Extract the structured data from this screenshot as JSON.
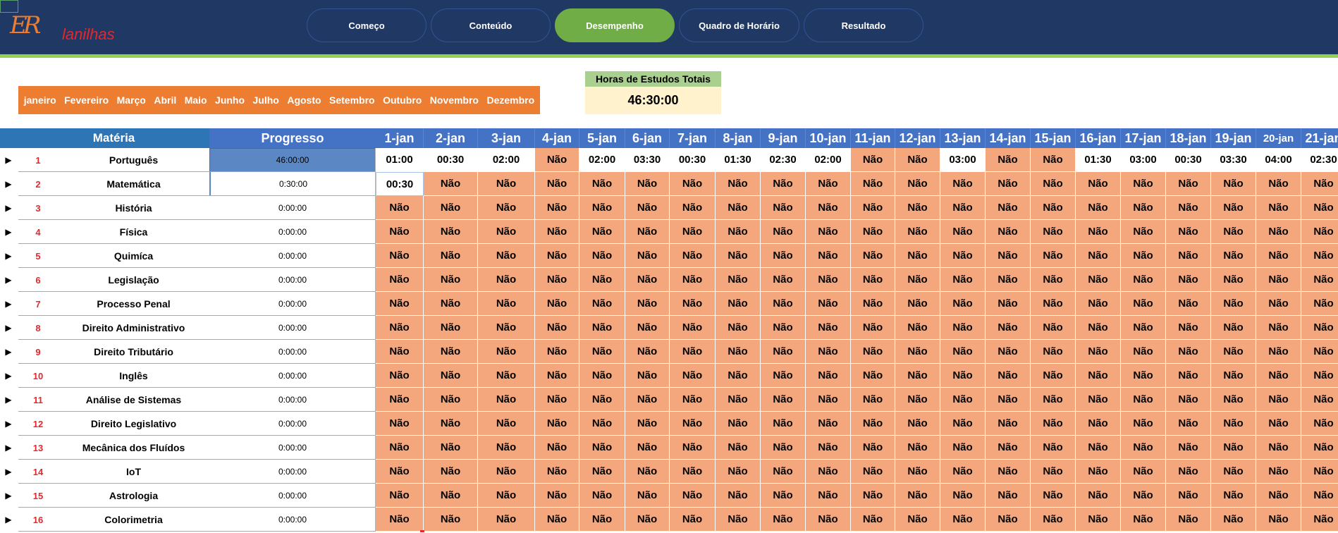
{
  "logo": {
    "script": "ER",
    "rest": "lanilhas"
  },
  "nav": [
    {
      "label": "Começo",
      "active": false
    },
    {
      "label": "Conteúdo",
      "active": false
    },
    {
      "label": "Desempenho",
      "active": true
    },
    {
      "label": "Quadro de Horário",
      "active": false
    },
    {
      "label": "Resultado",
      "active": false
    }
  ],
  "months": [
    "janeiro",
    "Fevereiro",
    "Março",
    "Abril",
    "Maio",
    "Junho",
    "Julho",
    "Agosto",
    "Setembro",
    "Outubro",
    "Novembro",
    "Dezembro"
  ],
  "total_hours": {
    "label": "Horas de Estudos Totais",
    "value": "46:30:00"
  },
  "table": {
    "header_materia": "Matéria",
    "header_progresso": "Progresso",
    "days": [
      "1-jan",
      "2-jan",
      "3-jan",
      "4-jan",
      "5-jan",
      "6-jan",
      "7-jan",
      "8-jan",
      "9-jan",
      "10-jan",
      "11-jan",
      "12-jan",
      "13-jan",
      "14-jan",
      "15-jan",
      "16-jan",
      "17-jan",
      "18-jan",
      "19-jan",
      "20-jan",
      "21-jan"
    ],
    "rows": [
      {
        "num": "1",
        "subject": "Português",
        "progress": "46:00:00",
        "values": [
          "01:00",
          "00:30",
          "02:00",
          "Não",
          "02:00",
          "03:30",
          "00:30",
          "01:30",
          "02:30",
          "02:00",
          "Não",
          "Não",
          "03:00",
          "Não",
          "Não",
          "01:30",
          "03:00",
          "00:30",
          "03:30",
          "04:00",
          "02:30"
        ]
      },
      {
        "num": "2",
        "subject": "Matemática",
        "progress": "0:30:00",
        "values": [
          "00:30",
          "Não",
          "Não",
          "Não",
          "Não",
          "Não",
          "Não",
          "Não",
          "Não",
          "Não",
          "Não",
          "Não",
          "Não",
          "Não",
          "Não",
          "Não",
          "Não",
          "Não",
          "Não",
          "Não",
          "Não"
        ]
      },
      {
        "num": "3",
        "subject": "História",
        "progress": "0:00:00",
        "values": []
      },
      {
        "num": "4",
        "subject": "Física",
        "progress": "0:00:00",
        "values": []
      },
      {
        "num": "5",
        "subject": "Quimíca",
        "progress": "0:00:00",
        "values": []
      },
      {
        "num": "6",
        "subject": "Legislação",
        "progress": "0:00:00",
        "values": []
      },
      {
        "num": "7",
        "subject": "Processo Penal",
        "progress": "0:00:00",
        "values": []
      },
      {
        "num": "8",
        "subject": "Direito Administrativo",
        "progress": "0:00:00",
        "values": []
      },
      {
        "num": "9",
        "subject": "Direito Tributário",
        "progress": "0:00:00",
        "values": []
      },
      {
        "num": "10",
        "subject": "Inglês",
        "progress": "0:00:00",
        "values": []
      },
      {
        "num": "11",
        "subject": "Análise de Sistemas",
        "progress": "0:00:00",
        "values": []
      },
      {
        "num": "12",
        "subject": "Direito Legislativo",
        "progress": "0:00:00",
        "values": []
      },
      {
        "num": "13",
        "subject": "Mecânica dos Fluídos",
        "progress": "0:00:00",
        "values": []
      },
      {
        "num": "14",
        "subject": "IoT",
        "progress": "0:00:00",
        "values": []
      },
      {
        "num": "15",
        "subject": "Astrologia",
        "progress": "0:00:00",
        "values": []
      },
      {
        "num": "16",
        "subject": "Colorimetria",
        "progress": "0:00:00",
        "values": []
      }
    ],
    "default_value": "Não",
    "row_arrow": "▶"
  },
  "colors": {
    "header_bg": "#1f3864",
    "accent_green": "#70ad47",
    "month_bar": "#ed7d31",
    "nao_cell": "#f4a77d",
    "header_blue": "#4472c4"
  }
}
